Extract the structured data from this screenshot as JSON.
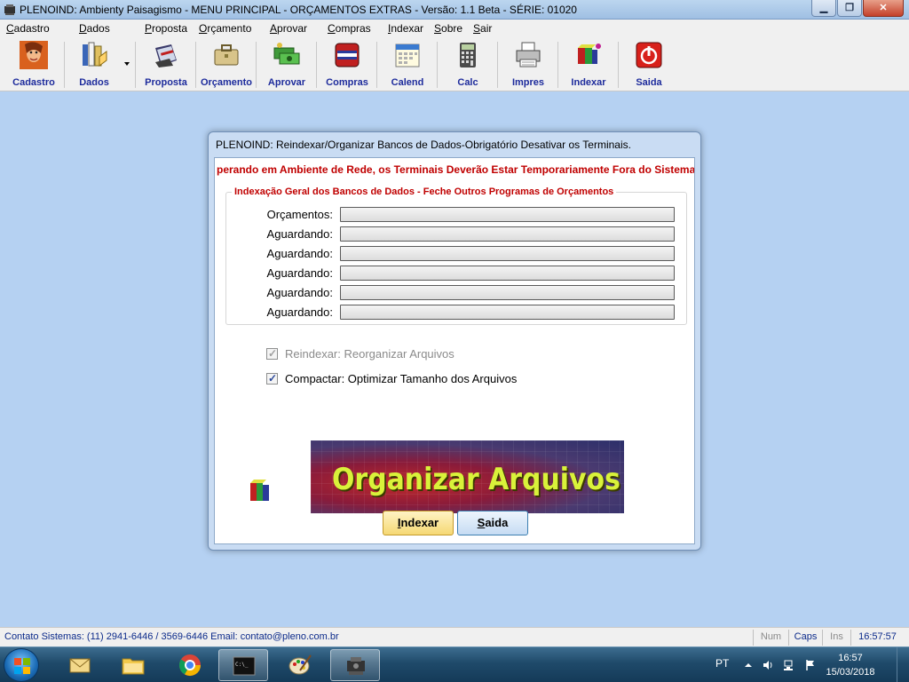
{
  "window": {
    "title": "PLENOIND: Ambienty Paisagismo - MENU PRINCIPAL - ORÇAMENTOS EXTRAS - Versão: 1.1 Beta - SÉRIE: 01020",
    "controls": {
      "minimize": "▁",
      "maximize": "❐",
      "close": "✕"
    }
  },
  "menubar": {
    "items": [
      {
        "first": "C",
        "rest": "adastro"
      },
      {
        "first": "D",
        "rest": "ados"
      },
      {
        "first": "P",
        "rest": "roposta"
      },
      {
        "first": "O",
        "rest": "rçamento"
      },
      {
        "first": "A",
        "rest": "provar"
      },
      {
        "first": "C",
        "rest": "ompras"
      },
      {
        "first": "I",
        "rest": "ndexar"
      },
      {
        "first": "S",
        "rest": "obre"
      },
      {
        "first": "S",
        "rest": "air"
      }
    ]
  },
  "toolbar": {
    "buttons": [
      {
        "label": "Cadastro",
        "icon": "person-icon"
      },
      {
        "label": "Dados",
        "icon": "books-icon"
      },
      {
        "label": "Proposta",
        "icon": "document-stack-icon"
      },
      {
        "label": "Orçamento",
        "icon": "briefcase-icon"
      },
      {
        "label": "Aprovar",
        "icon": "money-icon"
      },
      {
        "label": "Compras",
        "icon": "shopping-icon"
      },
      {
        "label": "Calend",
        "icon": "calendar-icon"
      },
      {
        "label": "Calc",
        "icon": "calculator-icon"
      },
      {
        "label": "Impres",
        "icon": "printer-icon"
      },
      {
        "label": "Indexar",
        "icon": "blocks-icon"
      },
      {
        "label": "Saida",
        "icon": "power-icon"
      }
    ]
  },
  "dialog": {
    "title": "PLENOIND: Reindexar/Organizar Bancos de Dados-Obrigatório Desativar os Terminais.",
    "warning": "perando em Ambiente de Rede, os Terminais Deverão Estar Temporariamente Fora do Sistema.",
    "group_title": "Indexação Geral dos Bancos de Dados - Feche Outros Programas de Orçamentos",
    "progress": [
      {
        "label": "Orçamentos:",
        "value": 0
      },
      {
        "label": "Aguardando:",
        "value": 0
      },
      {
        "label": "Aguardando:",
        "value": 0
      },
      {
        "label": "Aguardando:",
        "value": 0
      },
      {
        "label": "Aguardando:",
        "value": 0
      },
      {
        "label": "Aguardando:",
        "value": 0
      }
    ],
    "check_reindex": {
      "label": "Reindexar: Reorganizar Arquivos",
      "checked": true,
      "enabled": false
    },
    "check_compact": {
      "label": "Compactar: Optimizar Tamanho dos Arquivos",
      "checked": true,
      "enabled": true
    },
    "banner_text": "Organizar Arquivos :",
    "btn_index": {
      "first": "I",
      "rest": "ndexar"
    },
    "btn_exit": {
      "first": "S",
      "rest": "aida"
    }
  },
  "statusbar": {
    "contact": "Contato Sistemas: (11) 2941-6446 / 3569-6446 Email: contato@pleno.com.br",
    "num": "Num",
    "caps": "Caps",
    "ins": "Ins",
    "time": "16:57:57"
  },
  "taskbar": {
    "lang": "PT",
    "time": "16:57",
    "date": "15/03/2018"
  },
  "colors": {
    "desktop": "#b5d1f2",
    "warning_red": "#c00000",
    "toolbar_label": "#1d2b9c",
    "banner_text": "#d9f23a"
  }
}
